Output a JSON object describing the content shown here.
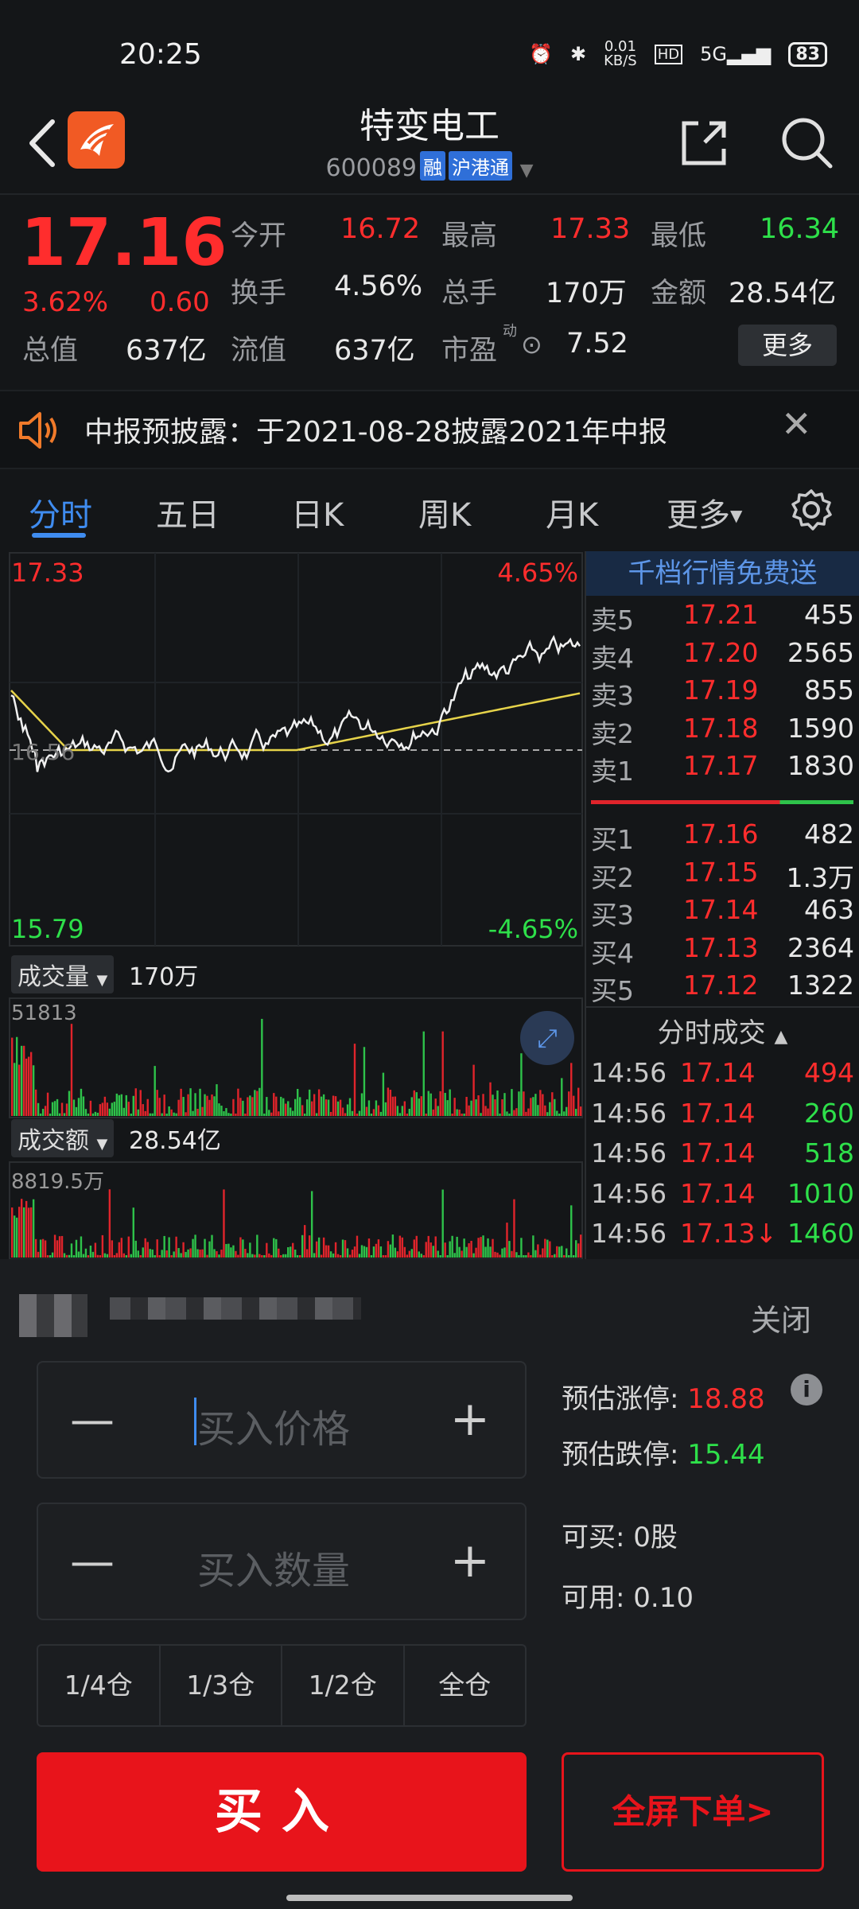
{
  "status": {
    "time": "20:25",
    "speed": "0.01\nKB/S",
    "battery": "83"
  },
  "header": {
    "title": "特变电工",
    "code": "600089",
    "tag1": "融",
    "tag2": "沪港通"
  },
  "quote": {
    "price": "17.16",
    "pct": "3.62%",
    "change": "0.60",
    "cells": [
      {
        "label": "今开",
        "value": "16.72",
        "color": "red"
      },
      {
        "label": "最高",
        "value": "17.33",
        "color": "red"
      },
      {
        "label": "最低",
        "value": "16.34",
        "color": "green"
      },
      {
        "label": "换手",
        "value": "4.56%",
        "color": "white"
      },
      {
        "label": "总手",
        "value": "170万",
        "color": "white"
      },
      {
        "label": "金额",
        "value": "28.54亿",
        "color": "white"
      },
      {
        "label": "总值",
        "value": "637亿",
        "color": "white"
      },
      {
        "label": "流值",
        "value": "637亿",
        "color": "white"
      },
      {
        "label": "市盈",
        "value": "7.52",
        "color": "white"
      }
    ],
    "pe_sup": "动",
    "more": "更多"
  },
  "notice": {
    "text": "中报预披露：于2021-08-28披露2021年中报"
  },
  "tabs": [
    "分时",
    "五日",
    "日K",
    "周K",
    "月K",
    "更多"
  ],
  "chart": {
    "high": "17.33",
    "high_pct": "4.65%",
    "low": "15.79",
    "low_pct": "-4.65%",
    "mid": "16.56",
    "vol_label": "成交量",
    "vol_total": "170万",
    "vol_max": "51813",
    "amt_label": "成交额",
    "amt_total": "28.54亿",
    "amt_max": "8819.5万",
    "line_color": "#f0f0f0",
    "avg_color": "#e6d34a"
  },
  "orderbook": {
    "title": "千档行情免费送",
    "asks": [
      {
        "label": "卖5",
        "price": "17.21",
        "vol": "455"
      },
      {
        "label": "卖4",
        "price": "17.20",
        "vol": "2565"
      },
      {
        "label": "卖3",
        "price": "17.19",
        "vol": "855"
      },
      {
        "label": "卖2",
        "price": "17.18",
        "vol": "1590"
      },
      {
        "label": "卖1",
        "price": "17.17",
        "vol": "1830"
      }
    ],
    "bids": [
      {
        "label": "买1",
        "price": "17.16",
        "vol": "482"
      },
      {
        "label": "买2",
        "price": "17.15",
        "vol": "1.3万"
      },
      {
        "label": "买3",
        "price": "17.14",
        "vol": "463"
      },
      {
        "label": "买4",
        "price": "17.13",
        "vol": "2364"
      },
      {
        "label": "买5",
        "price": "17.12",
        "vol": "1322"
      }
    ],
    "ticks_title": "分时成交",
    "ticks": [
      {
        "time": "14:56",
        "price": "17.14",
        "vol": "494",
        "color": "red"
      },
      {
        "time": "14:56",
        "price": "17.14",
        "vol": "260",
        "color": "green"
      },
      {
        "time": "14:56",
        "price": "17.14",
        "vol": "518",
        "color": "green"
      },
      {
        "time": "14:56",
        "price": "17.14",
        "vol": "1010",
        "color": "green"
      },
      {
        "time": "14:56",
        "price": "17.13↓",
        "vol": "1460",
        "color": "green"
      }
    ]
  },
  "trade": {
    "close": "关闭",
    "price_ph": "买入价格",
    "qty_ph": "买入数量",
    "limit_up_label": "预估涨停:",
    "limit_up": "18.88",
    "limit_down_label": "预估跌停:",
    "limit_down": "15.44",
    "can_buy_label": "可买:",
    "can_buy": "0股",
    "avail_label": "可用:",
    "avail": "0.10",
    "positions": [
      "1/4仓",
      "1/3仓",
      "1/2仓",
      "全仓"
    ],
    "buy": "买入",
    "fullscreen": "全屏下单>"
  }
}
